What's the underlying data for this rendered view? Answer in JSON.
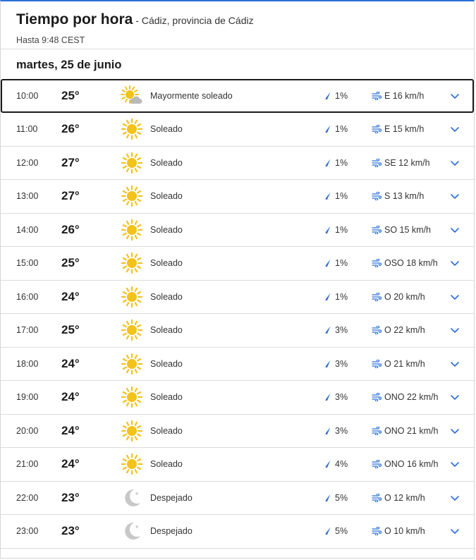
{
  "header": {
    "title": "Tiempo por hora",
    "location": "- Cádiz, provincia de Cádiz",
    "updated": "Hasta 9:48 CEST"
  },
  "date_label": "martes, 25 de junio",
  "colors": {
    "accent": "#2b6fd6",
    "sun": "#f3c21b",
    "moon": "#c8c8c8",
    "rain": "#2b6fd6",
    "wind": "#2b6fd6",
    "chevron": "#2b6fd6"
  },
  "hours": [
    {
      "time": "10:00",
      "temp": "25°",
      "icon": "partly-sunny-icon",
      "condition": "Mayormente soleado",
      "rain": "1%",
      "wind": "E 16 km/h"
    },
    {
      "time": "11:00",
      "temp": "26°",
      "icon": "sun-icon",
      "condition": "Soleado",
      "rain": "1%",
      "wind": "E 15 km/h"
    },
    {
      "time": "12:00",
      "temp": "27°",
      "icon": "sun-icon",
      "condition": "Soleado",
      "rain": "1%",
      "wind": "SE 12 km/h"
    },
    {
      "time": "13:00",
      "temp": "27°",
      "icon": "sun-icon",
      "condition": "Soleado",
      "rain": "1%",
      "wind": "S 13 km/h"
    },
    {
      "time": "14:00",
      "temp": "26°",
      "icon": "sun-icon",
      "condition": "Soleado",
      "rain": "1%",
      "wind": "SO 15 km/h"
    },
    {
      "time": "15:00",
      "temp": "25°",
      "icon": "sun-icon",
      "condition": "Soleado",
      "rain": "1%",
      "wind": "OSO 18 km/h"
    },
    {
      "time": "16:00",
      "temp": "24°",
      "icon": "sun-icon",
      "condition": "Soleado",
      "rain": "1%",
      "wind": "O 20 km/h"
    },
    {
      "time": "17:00",
      "temp": "25°",
      "icon": "sun-icon",
      "condition": "Soleado",
      "rain": "3%",
      "wind": "O 22 km/h"
    },
    {
      "time": "18:00",
      "temp": "24°",
      "icon": "sun-icon",
      "condition": "Soleado",
      "rain": "3%",
      "wind": "O 21 km/h"
    },
    {
      "time": "19:00",
      "temp": "24°",
      "icon": "sun-icon",
      "condition": "Soleado",
      "rain": "3%",
      "wind": "ONO 22 km/h"
    },
    {
      "time": "20:00",
      "temp": "24°",
      "icon": "sun-icon",
      "condition": "Soleado",
      "rain": "3%",
      "wind": "ONO 21 km/h"
    },
    {
      "time": "21:00",
      "temp": "24°",
      "icon": "sun-icon",
      "condition": "Soleado",
      "rain": "4%",
      "wind": "ONO 16 km/h"
    },
    {
      "time": "22:00",
      "temp": "23°",
      "icon": "clear-night-icon",
      "condition": "Despejado",
      "rain": "5%",
      "wind": "O 12 km/h"
    },
    {
      "time": "23:00",
      "temp": "23°",
      "icon": "clear-night-icon",
      "condition": "Despejado",
      "rain": "5%",
      "wind": "O 10 km/h"
    }
  ]
}
